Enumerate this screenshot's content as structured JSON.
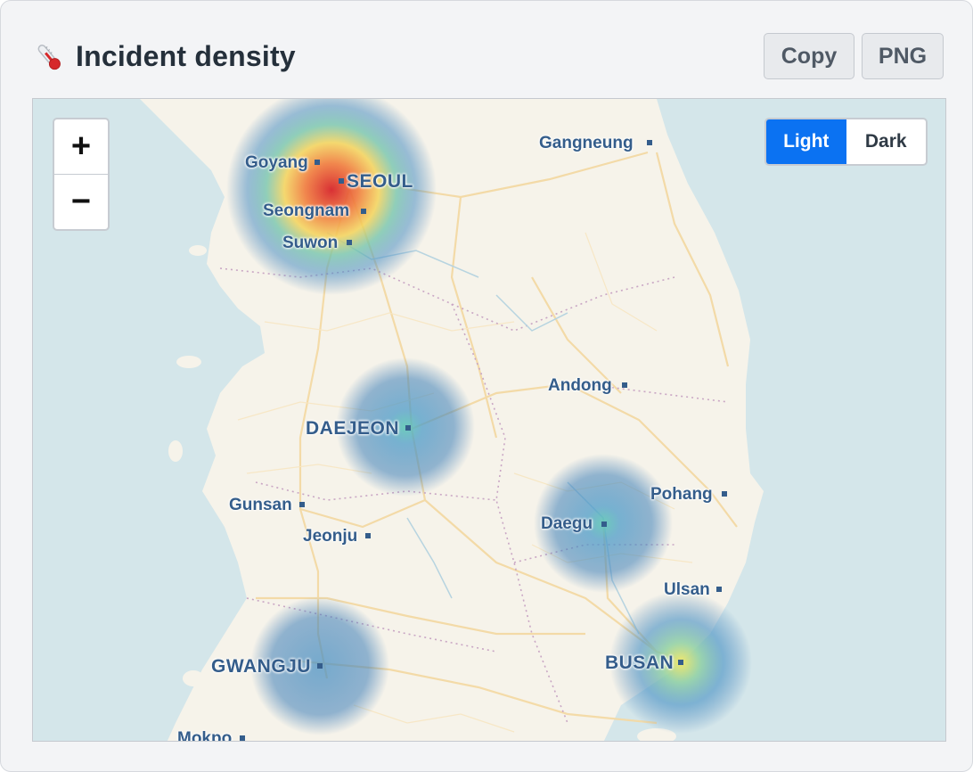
{
  "header": {
    "title": "Incident density",
    "icon": "thermometer-icon",
    "copy_label": "Copy",
    "png_label": "PNG"
  },
  "map": {
    "zoom_in_label": "+",
    "zoom_out_label": "−",
    "theme_options": [
      "Light",
      "Dark"
    ],
    "theme_selected": "Light",
    "colors": {
      "water": "#d4e6ea",
      "land": "#f6f3ea",
      "label": "#345d8b",
      "accent": "#0b72f2"
    },
    "cities": [
      {
        "id": "seoul",
        "name": "SEOUL",
        "major": true
      },
      {
        "id": "goyang",
        "name": "Goyang",
        "major": false
      },
      {
        "id": "seongnam",
        "name": "Seongnam",
        "major": false
      },
      {
        "id": "suwon",
        "name": "Suwon",
        "major": false
      },
      {
        "id": "gangneung",
        "name": "Gangneung",
        "major": false
      },
      {
        "id": "andong",
        "name": "Andong",
        "major": false
      },
      {
        "id": "daejeon",
        "name": "DAEJEON",
        "major": true
      },
      {
        "id": "pohang",
        "name": "Pohang",
        "major": false
      },
      {
        "id": "gunsan",
        "name": "Gunsan",
        "major": false
      },
      {
        "id": "daegu",
        "name": "Daegu",
        "major": false
      },
      {
        "id": "jeonju",
        "name": "Jeonju",
        "major": false
      },
      {
        "id": "ulsan",
        "name": "Ulsan",
        "major": false
      },
      {
        "id": "gwangju",
        "name": "GWANGJU",
        "major": true
      },
      {
        "id": "busan",
        "name": "BUSAN",
        "major": true
      },
      {
        "id": "mokpo",
        "name": "Mokpo",
        "major": false
      }
    ],
    "heat_intensity": {
      "seoul": 1.0,
      "daejeon": 0.45,
      "daegu": 0.45,
      "gwangju": 0.35,
      "busan": 0.7
    }
  }
}
